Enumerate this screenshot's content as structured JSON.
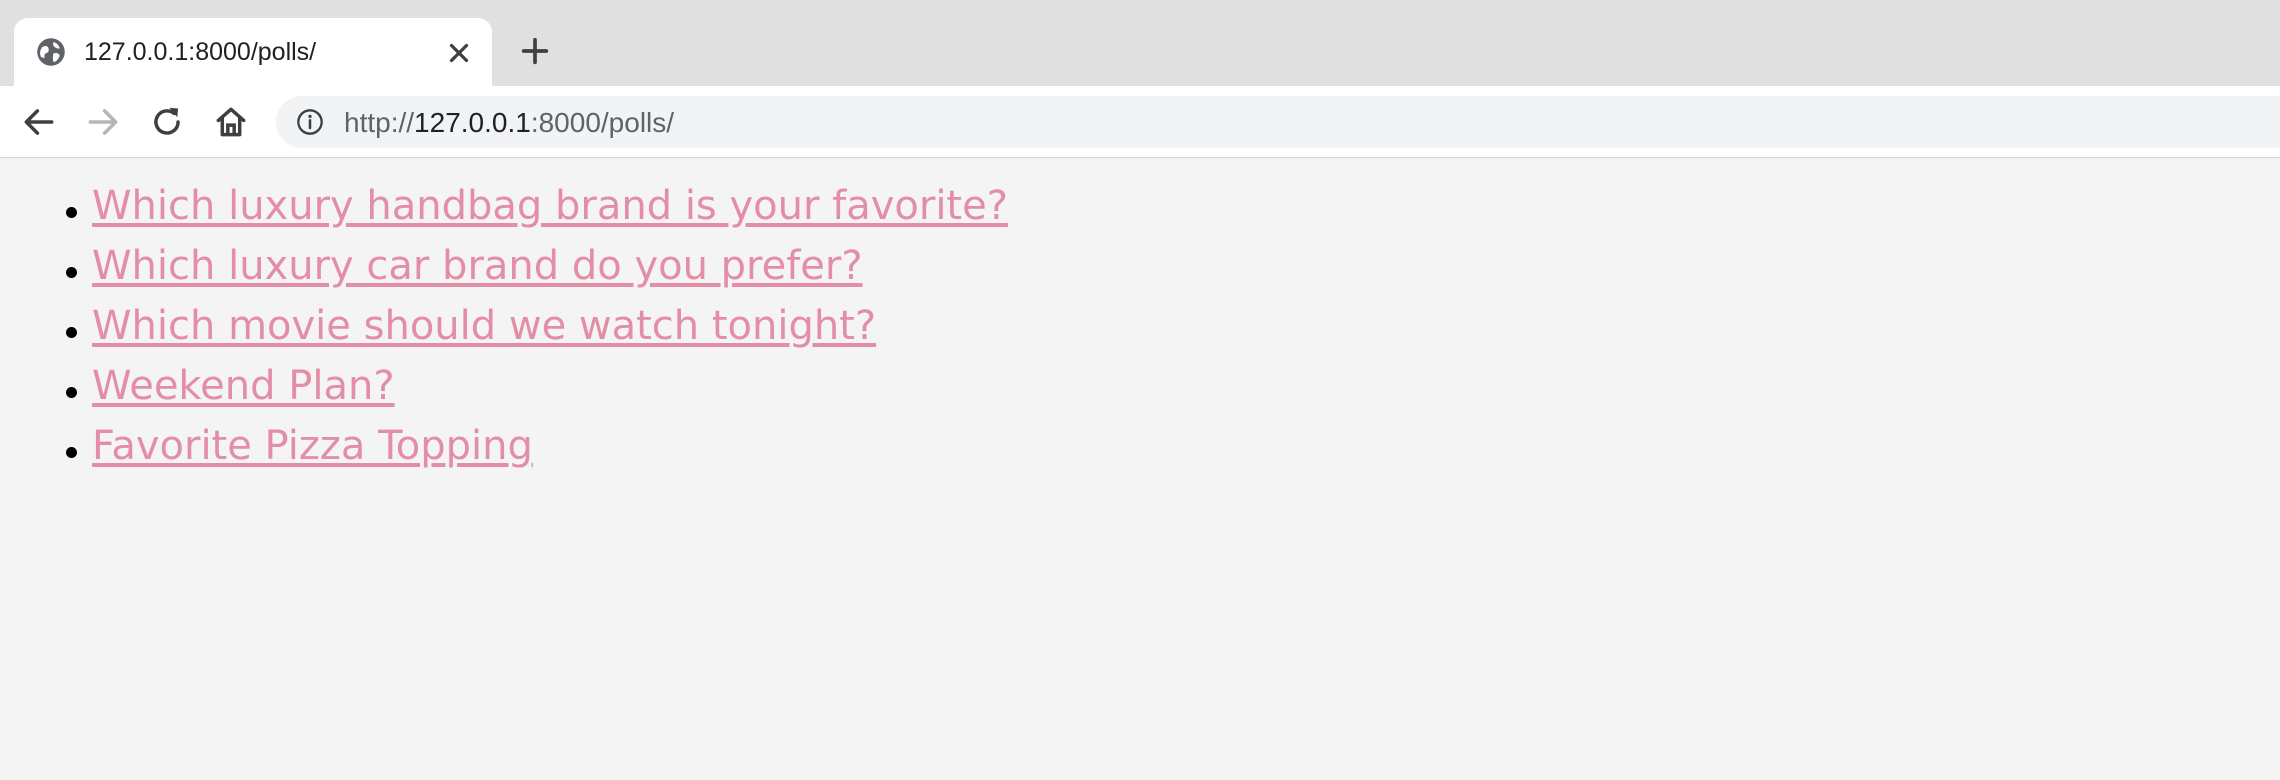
{
  "browser": {
    "tab": {
      "title": "127.0.0.1:8000/polls/",
      "favicon": "globe-icon",
      "close_icon": "close-icon"
    },
    "new_tab_icon": "plus-icon",
    "toolbar": {
      "back_icon": "arrow-left-icon",
      "forward_icon": "arrow-right-icon",
      "reload_icon": "reload-icon",
      "home_icon": "home-icon"
    },
    "address_bar": {
      "site_info_icon": "info-icon",
      "scheme": "http://",
      "host": "127.0.0.1",
      "port_path": ":8000/polls/"
    }
  },
  "page": {
    "link_color": "#e38ea6",
    "polls": [
      {
        "question": "Which luxury handbag brand is your favorite?"
      },
      {
        "question": "Which luxury car brand do you prefer?"
      },
      {
        "question": "Which movie should we watch tonight?"
      },
      {
        "question": "Weekend Plan?"
      },
      {
        "question": "Favorite Pizza Topping"
      }
    ]
  }
}
